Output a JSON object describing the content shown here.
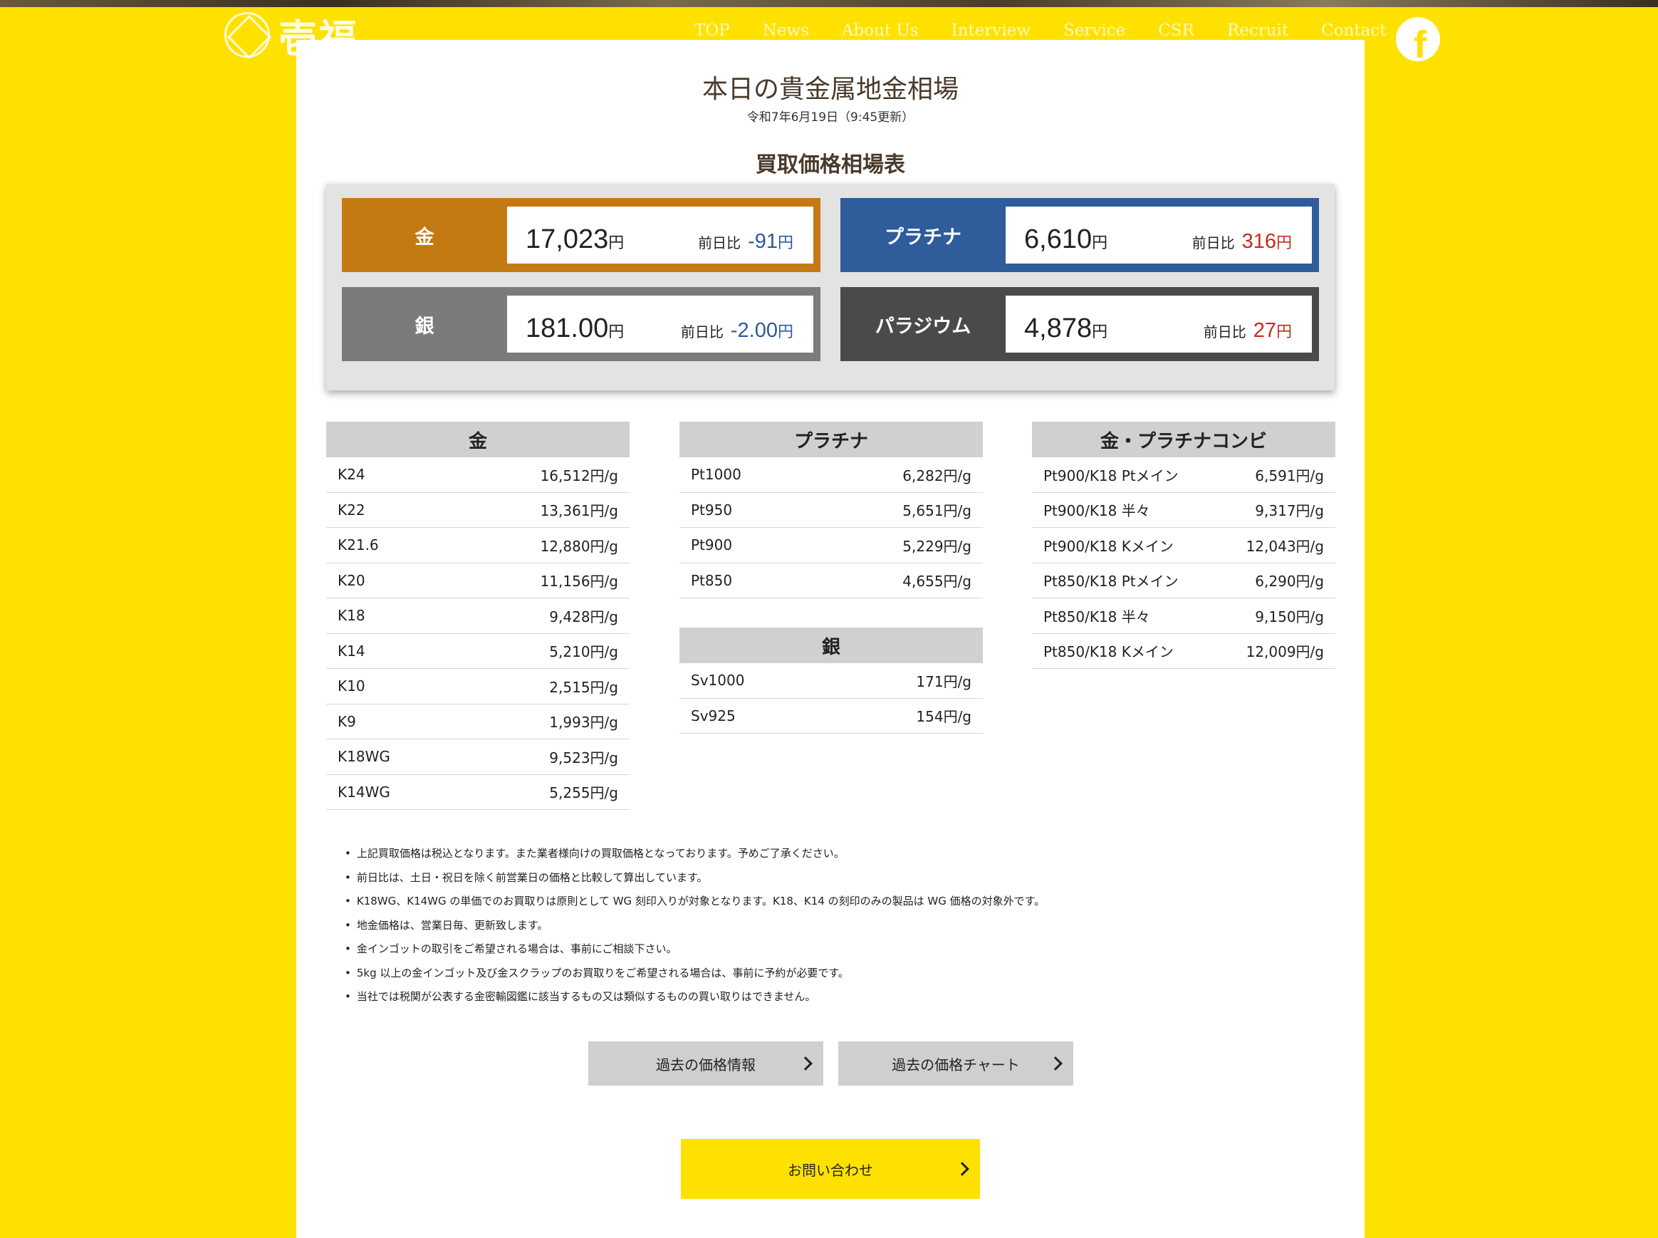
{
  "header": {
    "logo_text": "壱福",
    "nav": [
      "TOP",
      "News",
      "About Us",
      "Interview",
      "Service",
      "CSR",
      "Recruit",
      "Contact"
    ],
    "social_icon": "facebook-icon"
  },
  "page": {
    "title": "本日の貴金属地金相場",
    "updated": "令和7年6月19日（9:45更新）",
    "subtitle": "買取価格相場表"
  },
  "rates": [
    {
      "name": "金",
      "price": "17,023",
      "unit": "円",
      "diff_label": "前日比",
      "diff": "-91",
      "diff_unit": "円",
      "color": "#c47a12"
    },
    {
      "name": "プラチナ",
      "price": "6,610",
      "unit": "円",
      "diff_label": "前日比",
      "diff": "316",
      "diff_unit": "円",
      "color": "#2f5c9a"
    },
    {
      "name": "銀",
      "price": "181.00",
      "unit": "円",
      "diff_label": "前日比",
      "diff": "-2.00",
      "diff_unit": "円",
      "color": "#7b7b7b"
    },
    {
      "name": "パラジウム",
      "price": "4,878",
      "unit": "円",
      "diff_label": "前日比",
      "diff": "27",
      "diff_unit": "円",
      "color": "#4a4a4a"
    }
  ],
  "tables": {
    "gold": {
      "title": "金",
      "rows": [
        [
          "K24",
          "16,512円/g"
        ],
        [
          "K22",
          "13,361円/g"
        ],
        [
          "K21.6",
          "12,880円/g"
        ],
        [
          "K20",
          "11,156円/g"
        ],
        [
          "K18",
          "9,428円/g"
        ],
        [
          "K14",
          "5,210円/g"
        ],
        [
          "K10",
          "2,515円/g"
        ],
        [
          "K9",
          "1,993円/g"
        ],
        [
          "K18WG",
          "9,523円/g"
        ],
        [
          "K14WG",
          "5,255円/g"
        ]
      ]
    },
    "platinum": {
      "title": "プラチナ",
      "rows": [
        [
          "Pt1000",
          "6,282円/g"
        ],
        [
          "Pt950",
          "5,651円/g"
        ],
        [
          "Pt900",
          "5,229円/g"
        ],
        [
          "Pt850",
          "4,655円/g"
        ]
      ]
    },
    "silver": {
      "title": "銀",
      "rows": [
        [
          "Sv1000",
          "171円/g"
        ],
        [
          "Sv925",
          "154円/g"
        ]
      ]
    },
    "combi": {
      "title": "金・プラチナコンビ",
      "rows": [
        [
          "Pt900/K18 Ptメイン",
          "6,591円/g"
        ],
        [
          "Pt900/K18 半々",
          "9,317円/g"
        ],
        [
          "Pt900/K18 Kメイン",
          "12,043円/g"
        ],
        [
          "Pt850/K18 Ptメイン",
          "6,290円/g"
        ],
        [
          "Pt850/K18 半々",
          "9,150円/g"
        ],
        [
          "Pt850/K18 Kメイン",
          "12,009円/g"
        ]
      ]
    }
  },
  "notes": [
    "上記買取価格は税込となります。また業者様向けの買取価格となっております。予めご了承ください。",
    "前日比は、土日・祝日を除く前営業日の価格と比較して算出しています。",
    "K18WG、K14WG の単価でのお買取りは原則として WG 刻印入りが対象となります。K18、K14 の刻印のみの製品は WG 価格の対象外です。",
    "地金価格は、営業日毎、更新致します。",
    "金インゴットの取引をご希望される場合は、事前にご相談下さい。",
    "5kg 以上の金インゴット及び金スクラップのお買取りをご希望される場合は、事前に予約が必要です。",
    "当社では税関が公表する金密輸図鑑に該当するもの又は類似するものの買い取りはできません。"
  ],
  "buttons": {
    "past_prices": "過去の価格情報",
    "past_chart": "過去の価格チャート",
    "contact": "お問い合わせ"
  }
}
